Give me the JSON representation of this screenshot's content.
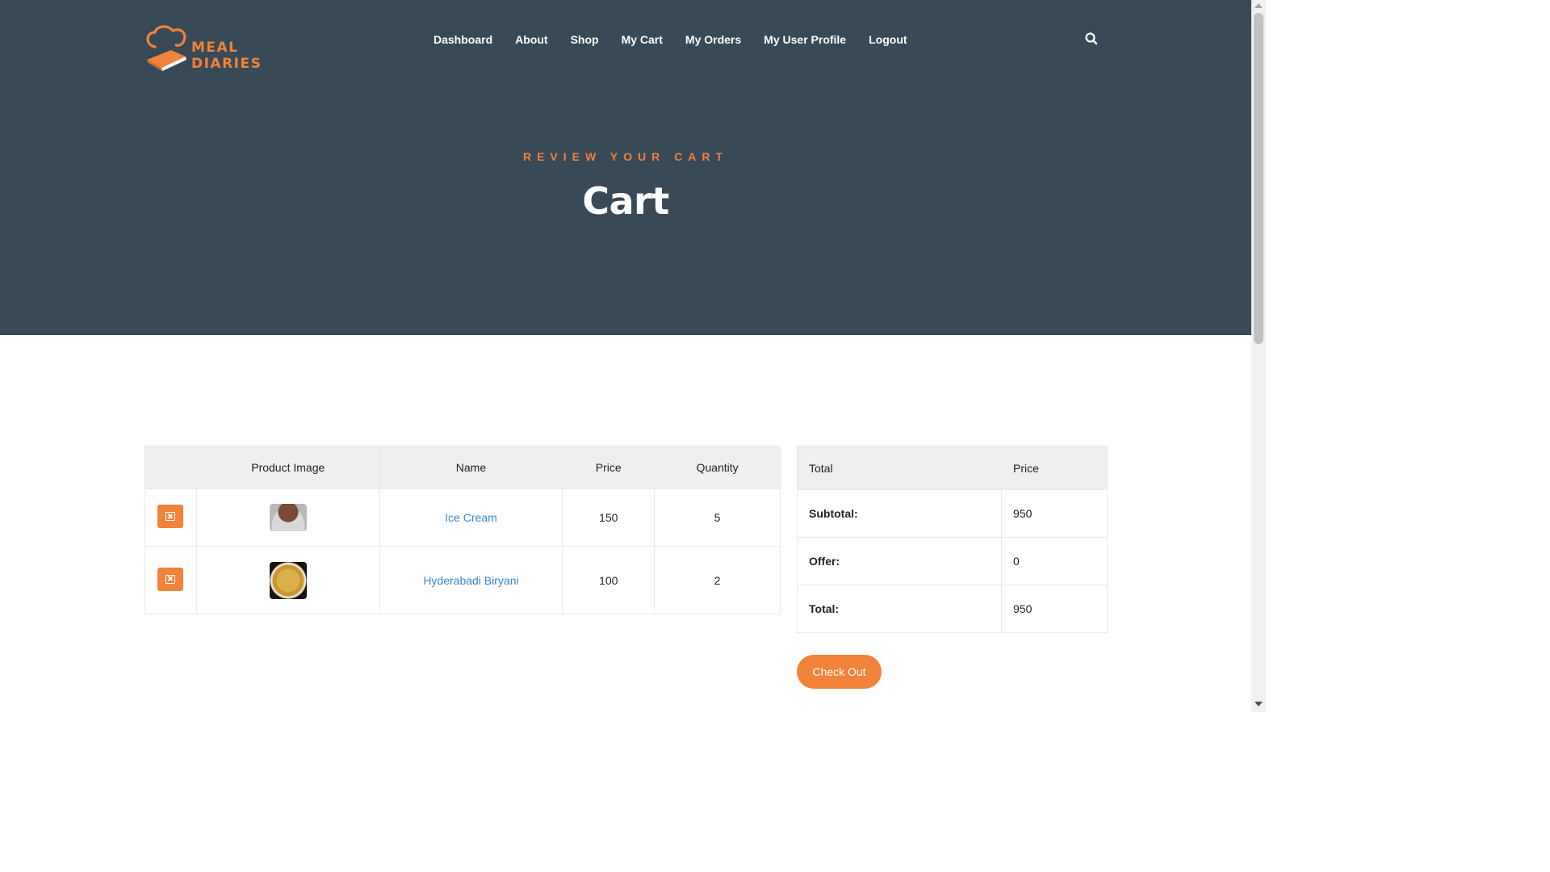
{
  "brand": {
    "line1": "MEAL",
    "line2": "DIARIES",
    "icon": "chef-hat-book-icon",
    "color": "#f0823a"
  },
  "nav": [
    {
      "label": "Dashboard"
    },
    {
      "label": "About"
    },
    {
      "label": "Shop"
    },
    {
      "label": "My Cart"
    },
    {
      "label": "My Orders"
    },
    {
      "label": "My User Profile"
    },
    {
      "label": "Logout"
    }
  ],
  "search": {
    "icon": "search-icon"
  },
  "hero": {
    "eyebrow": "REVIEW YOUR CART",
    "title": "Cart",
    "background": "#384a57"
  },
  "cart": {
    "headers": {
      "remove": "",
      "image": "Product Image",
      "name": "Name",
      "price": "Price",
      "quantity": "Quantity"
    },
    "items": [
      {
        "name": "Ice Cream",
        "price": "150",
        "quantity": "5",
        "image": "ice-cream-thumbnail"
      },
      {
        "name": "Hyderabadi Biryani",
        "price": "100",
        "quantity": "2",
        "image": "biryani-thumbnail"
      }
    ]
  },
  "totals": {
    "headers": {
      "label": "Total",
      "value": "Price"
    },
    "rows": [
      {
        "label": "Subtotal:",
        "value": "950"
      },
      {
        "label": "Offer:",
        "value": "0"
      },
      {
        "label": "Total:",
        "value": "950"
      }
    ]
  },
  "checkout": {
    "label": "Check Out"
  },
  "accent": "#f0823a",
  "link_color": "#3b82d8"
}
